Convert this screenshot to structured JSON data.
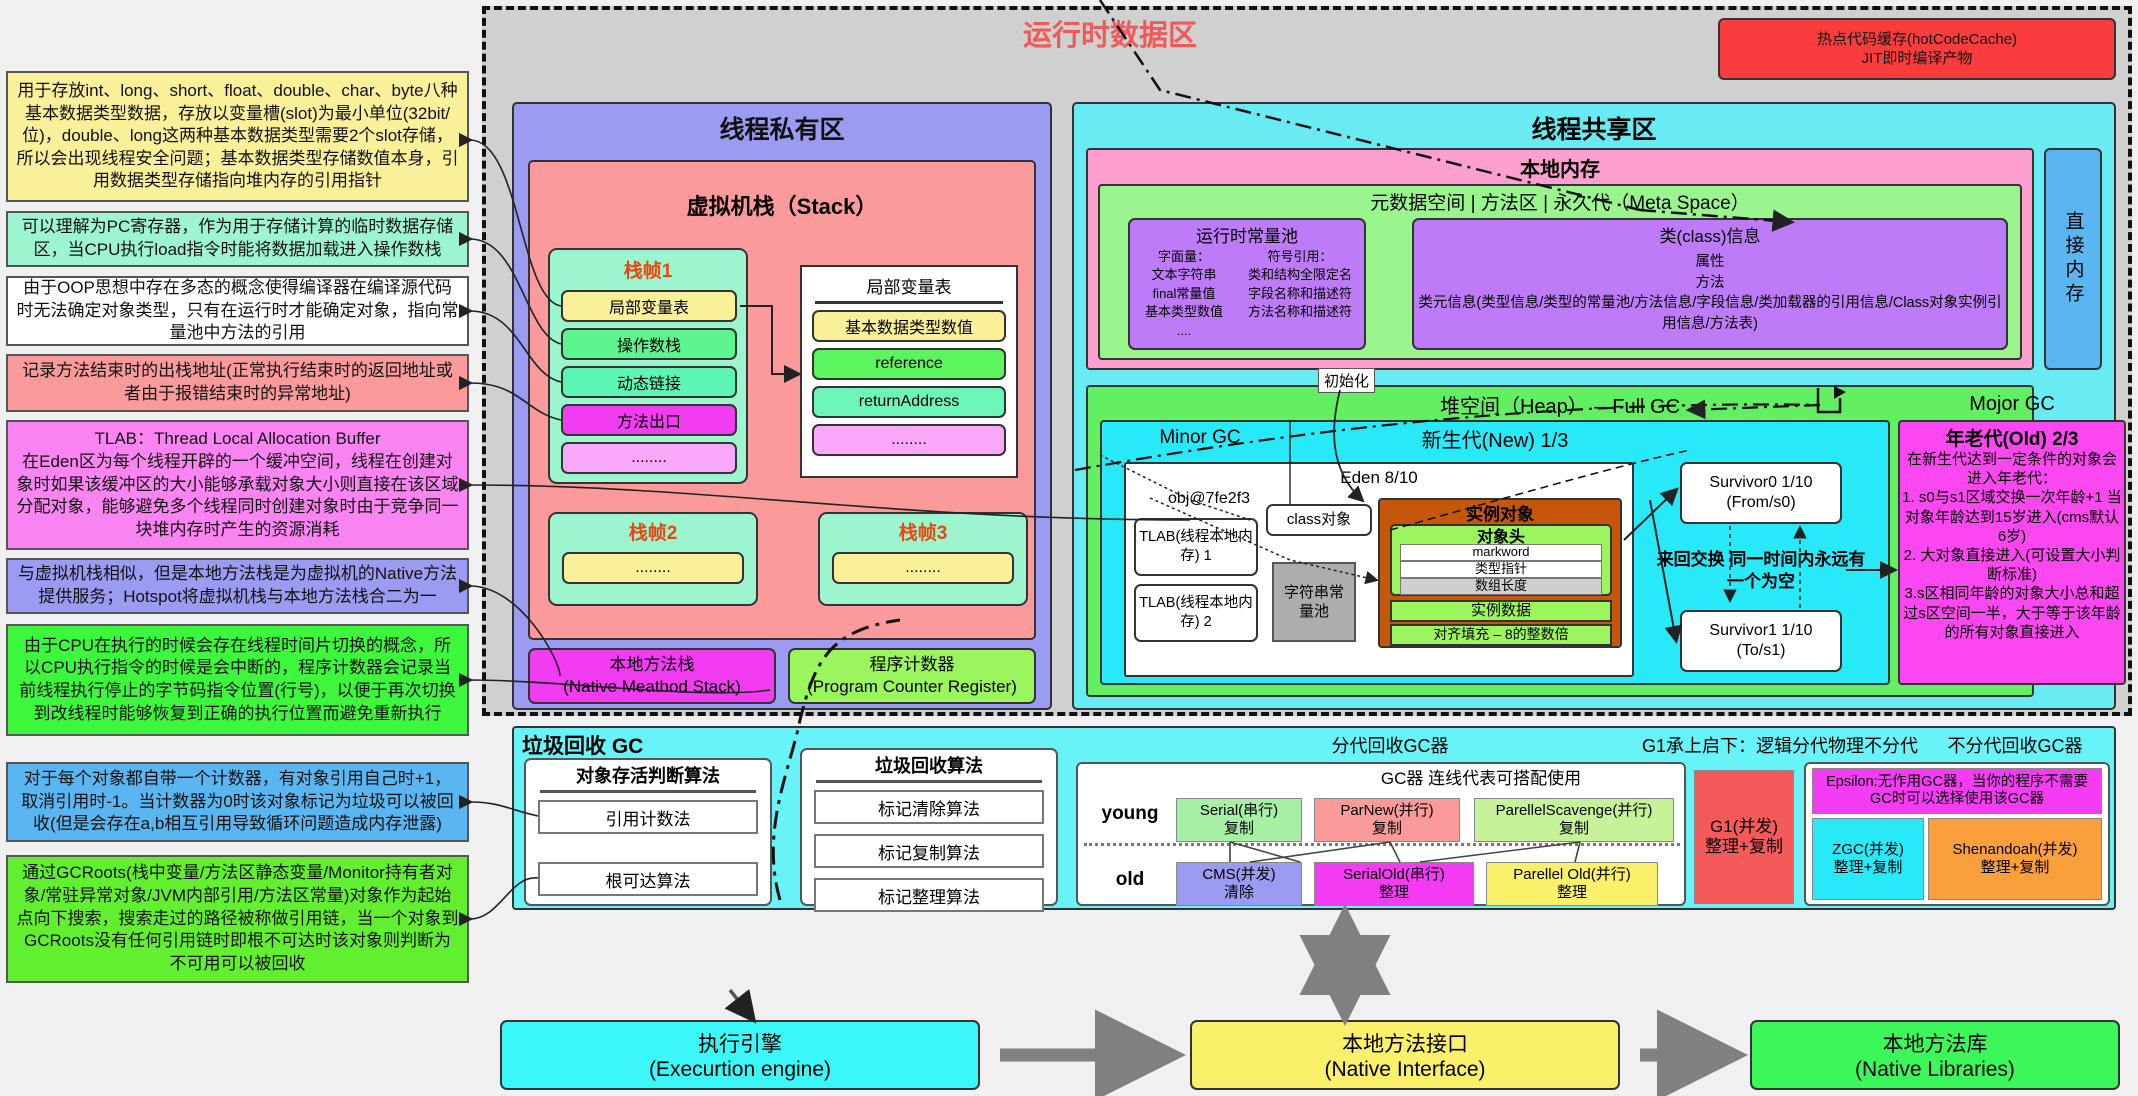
{
  "runtime": {
    "title": "运行时数据区",
    "hot_code": {
      "line1": "热点代码缓存(hotCodeCache)",
      "line2": "JIT即时编译产物"
    }
  },
  "notes": [
    {
      "name": "local-var-table-note",
      "color": "#faf09a",
      "text": "用于存放int、long、short、float、double、char、byte八种基本数据类型数据，存放以变量槽(slot)为最小单位(32bit/位)，double、long这两种基本数据类型需要2个slot存储，所以会出现线程安全问题；基本数据类型存储数值本身，引用数据类型存储指向堆内存的引用指针"
    },
    {
      "name": "operand-stack-note",
      "color": "#9df5cf",
      "text": "可以理解为PC寄存器，作为用于存储计算的临时数据存储区，当CPU执行load指令时能将数据加载进入操作数栈"
    },
    {
      "name": "dynamic-link-note",
      "color": "#ffffff",
      "text": "由于OOP思想中存在多态的概念使得编译器在编译源代码时无法确定对象类型，只有在运行时才能确定对象，指向常量池中方法的引用"
    },
    {
      "name": "method-exit-note",
      "color": "#fb9a9a",
      "text": "记录方法结束时的出栈地址(正常执行结束时的返回地址或者由于报错结束时的异常地址)"
    },
    {
      "name": "tlab-note",
      "color": "#fb84f3",
      "text": "TLAB：Thread Local Allocation Buffer\n在Eden区为每个线程开辟的一个缓冲空间，线程在创建对象时如果该缓冲区的大小能够承载对象大小则直接在该区域分配对象，能够避免多个线程同时创建对象时由于竞争同一块堆内存时产生的资源消耗"
    },
    {
      "name": "native-method-stack-note",
      "color": "#9b9bf2",
      "text": "与虚拟机栈相似，但是本地方法栈是为虚拟机的Native方法提供服务；Hotspot将虚拟机栈与本地方法栈合二为一"
    },
    {
      "name": "program-counter-note",
      "color": "#3cf73c",
      "text": "由于CPU在执行的时候会存在线程时间片切换的概念，所以CPU执行指令的时候是会中断的，程序计数器会记录当前线程执行停止的字节码指令位置(行号)，以便于再次切换到改线程时能够恢复到正确的执行位置而避免重新执行"
    },
    {
      "name": "reference-counting-note",
      "color": "#5ab6f0",
      "text": "对于每个对象都自带一个计数器，有对象引用自己时+1，取消引用时-1。当计数器为0时该对象标记为垃圾可以被回收(但是会存在a,b相互引用导致循环问题造成内存泄露)"
    },
    {
      "name": "gc-roots-note",
      "color": "#62ef2f",
      "text": "通过GCRoots(栈中变量/方法区静态变量/Monitor持有者对象/常驻异常对象/JVM内部引用/方法区常量)对象作为起始点向下搜索，搜索走过的路径被称做引用链，当一个对象到GCRoots没有任何引用链时即根不可达时该对象则判断为不可用可以被回收"
    }
  ],
  "thread_private": {
    "title": "线程私有区",
    "vm_stack_title": "虚拟机栈（Stack）",
    "frame1": {
      "title": "栈帧1",
      "slots": [
        {
          "label": "局部变量表",
          "color": "#faf09a"
        },
        {
          "label": "操作数栈",
          "color": "#5df58f"
        },
        {
          "label": "动态链接",
          "color": "#5df5b4"
        },
        {
          "label": "方法出口",
          "color": "#f23cf2"
        },
        {
          "label": "........",
          "color": "#f9a8f9"
        }
      ]
    },
    "frame2": {
      "title": "栈帧2",
      "slot": "........"
    },
    "frame3": {
      "title": "栈帧3",
      "slot": "........"
    },
    "lvt_panel": {
      "title": "局部变量表",
      "rows": [
        {
          "label": "基本数据类型数值",
          "color": "#faf09a"
        },
        {
          "label": "reference",
          "color": "#5df55d"
        },
        {
          "label": "returnAddress",
          "color": "#6ef5b8"
        },
        {
          "label": "........",
          "color": "#f9a8f9"
        }
      ]
    },
    "native_stack": {
      "line1": "本地方法栈",
      "line2": "(Native Meathod Stack)"
    },
    "pc_register": {
      "line1": "程序计数器",
      "line2": "(Program Counter Register)"
    }
  },
  "thread_shared": {
    "title": "线程共享区",
    "native_memory_title": "本地内存",
    "meta_space_title": "元数据空间 | 方法区 | 永久代（Meta Space）",
    "runtime_constant_pool": {
      "title": "运行时常量池",
      "col1": [
        "字面量：",
        "文本字符串",
        "final常量值",
        "基本类型数值",
        "...."
      ],
      "col2": [
        "符号引用：",
        "类和结构全限定名",
        "字段名称和描述符",
        "方法名称和描述符"
      ]
    },
    "class_info": {
      "title": "类(class)信息",
      "lines": [
        "属性",
        "方法",
        "类元信息(类型信息/类型的常量池/方法信息/字段信息/类加载器的引用信息/Class对象实例引用信息/方法表)"
      ]
    },
    "direct_memory": "直接内存",
    "heap": {
      "title": "堆空间（Heap） -- Full GC",
      "major_gc": "Mojor GC",
      "init_label": "初始化",
      "new_gen": {
        "title": "新生代(New) 1/3",
        "minor_gc": "Minor GC",
        "eden_title": "Eden 8/10",
        "obj_addr": "obj@7fe2f3",
        "tlab1": "TLAB(线程本地内存) 1",
        "tlab2": "TLAB(线程本地内存) 2",
        "string_pool": "字符串常量池",
        "class_obj": "class对象",
        "instance": {
          "title": "实例对象",
          "header_title": "对象头",
          "header_rows": [
            "markword",
            "类型指针",
            "数组长度"
          ],
          "instance_data": "实例数据",
          "padding": "对齐填充 – 8的整数倍"
        },
        "survivor0": {
          "line1": "Survivor0  1/10",
          "line2": "(From/s0)"
        },
        "survivor1": {
          "line1": "Survivor1  1/10",
          "line2": "(To/s1)"
        },
        "swap_note": "来回交换 同一时间内永远有一个为空"
      },
      "old_gen": {
        "title": "年老代(Old) 2/3",
        "text": "在新生代达到一定条件的对象会进入年老代：\n1. s0与s1区域交换一次年龄+1 当对象年龄达到15岁进入(cms默认6岁)\n2. 大对象直接进入(可设置大小判断标准)\n3.s区相同年龄的对象大小总和超过s区空间一半，大于等于该年龄的所有对象直接进入"
      }
    }
  },
  "gc": {
    "title": "垃圾回收 GC",
    "generational_label": "分代回收GC器",
    "g1_label": "G1承上启下：逻辑分代物理不分代",
    "non_generational_label": "不分代回收GC器",
    "collector_hint": "GC器 连线代表可搭配使用",
    "row_young": "young",
    "row_old": "old",
    "object_alive_alg": {
      "title": "对象存活判断算法",
      "items": [
        "引用计数法",
        "根可达算法"
      ]
    },
    "gc_alg": {
      "title": "垃圾回收算法",
      "items": [
        "标记清除算法",
        "标记复制算法",
        "标记整理算法"
      ]
    },
    "young_collectors": [
      {
        "name": "Serial(串行)",
        "mode": "复制",
        "color": "#a5f0a5"
      },
      {
        "name": "ParNew(并行)",
        "mode": "复制",
        "color": "#fb9a9a"
      },
      {
        "name": "ParellelScavenge(并行)",
        "mode": "复制",
        "color": "#c6f29a"
      }
    ],
    "old_collectors": [
      {
        "name": "CMS(并发)",
        "mode": "清除",
        "color": "#9b9bf2"
      },
      {
        "name": "SerialOld(串行)",
        "mode": "整理",
        "color": "#f43cf4"
      },
      {
        "name": "Parellel Old(并行)",
        "mode": "整理",
        "color": "#faf06a"
      }
    ],
    "g1": {
      "name": "G1(并发)",
      "mode": "整理+复制",
      "color": "#f45a5a"
    },
    "epsilon": "Epsilon:无作用GC器，当你的程序不需要GC时可以选择使用该GC器",
    "zgc": {
      "name": "ZGC(并发)",
      "mode": "整理+复制",
      "color": "#28e9f7"
    },
    "shenandoah": {
      "name": "Shenandoah(并发)",
      "mode": "整理+复制",
      "color": "#f9a03c"
    }
  },
  "bottom": {
    "execution_engine": {
      "line1": "执行引擎",
      "line2": "(Execurtion engine)",
      "color": "#3cf7f7"
    },
    "native_interface": {
      "line1": "本地方法接口",
      "line2": "(Native Interface)",
      "color": "#faf06a"
    },
    "native_libraries": {
      "line1": "本地方法库",
      "line2": "(Native Libraries)",
      "color": "#3cf75a"
    }
  }
}
